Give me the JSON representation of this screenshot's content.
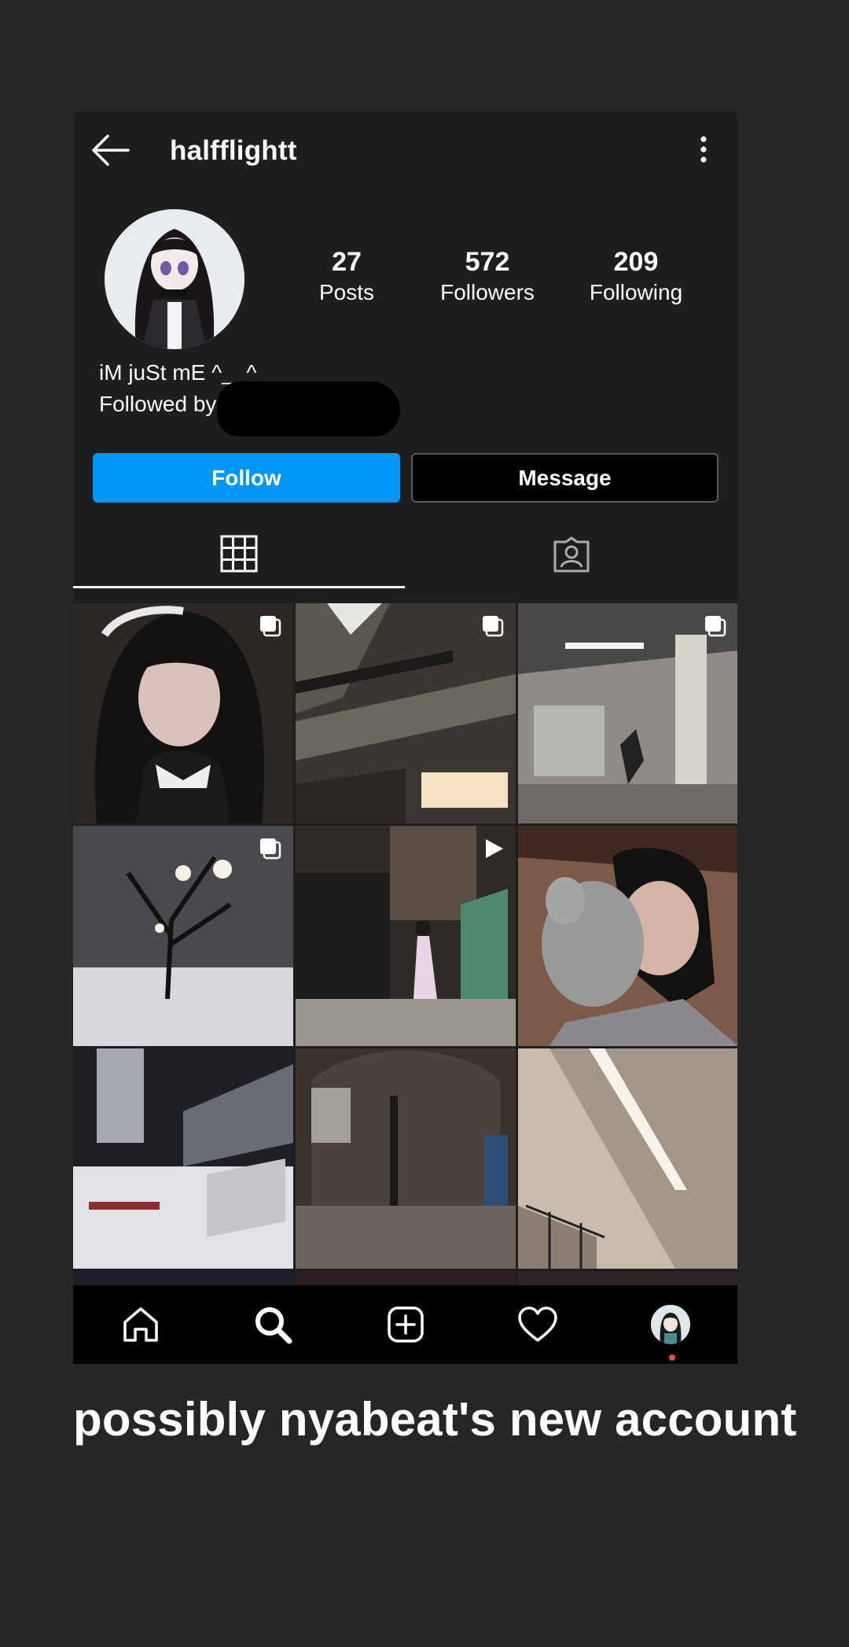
{
  "header": {
    "username": "halfflightt"
  },
  "stats": [
    {
      "value": "27",
      "label": "Posts"
    },
    {
      "value": "572",
      "label": "Followers"
    },
    {
      "value": "209",
      "label": "Following"
    }
  ],
  "bio": {
    "text": "iM juSt mE ^__^",
    "followed_by": "Followed by c"
  },
  "actions": {
    "follow_label": "Follow",
    "message_label": "Message"
  },
  "tabs": [
    {
      "name": "grid-icon",
      "selected": true
    },
    {
      "name": "tagged-icon",
      "selected": false
    }
  ],
  "grid_badges": [
    "carousel-icon",
    "carousel-icon",
    "carousel-icon",
    "carousel-icon",
    "reel-icon",
    "",
    "",
    "",
    ""
  ],
  "bottom_nav": [
    "home-icon",
    "search-icon",
    "create-icon",
    "activity-heart-icon",
    "profile-avatar"
  ],
  "caption": "possibly nyabeat's new account",
  "colors": {
    "background": "#262626",
    "phone_bg": "#1e1e1e",
    "follow_blue": "#0095f6",
    "notification_red": "#ed4956"
  }
}
